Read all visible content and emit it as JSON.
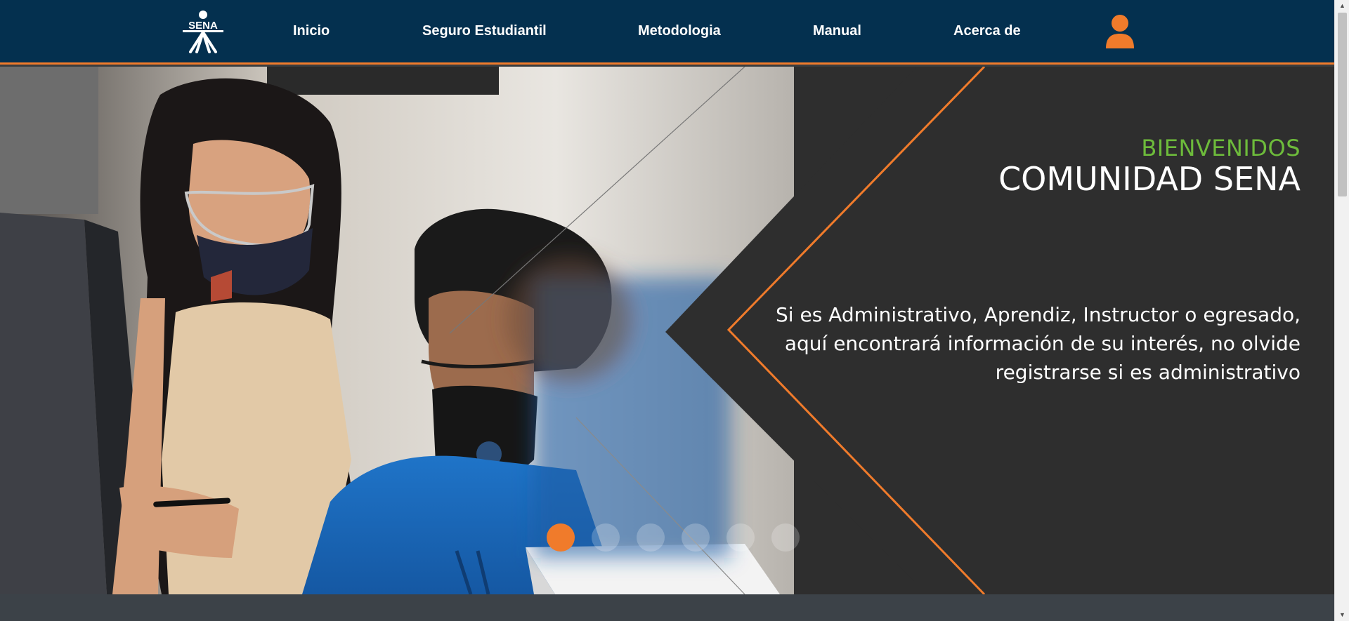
{
  "header": {
    "logo_text": "SENA",
    "nav": [
      {
        "label": "Inicio"
      },
      {
        "label": "Seguro Estudiantil"
      },
      {
        "label": "Metodologia"
      },
      {
        "label": "Manual"
      },
      {
        "label": "Acerca de"
      }
    ],
    "user_icon": "user-icon"
  },
  "hero": {
    "kicker": "BIENVENIDOS",
    "title": "COMUNIDAD SENA",
    "message": "Si es Administrativo, Aprendiz, Instructor o egresado, aquí encontrará información de su interés, no olvide registrarse si es administrativo",
    "carousel": {
      "slides": 6,
      "active_slide": 1
    }
  },
  "colors": {
    "header_bg": "#04304f",
    "accent": "#f07b2b",
    "kicker": "#6dbb3b",
    "panel": "#2e2e2e"
  }
}
